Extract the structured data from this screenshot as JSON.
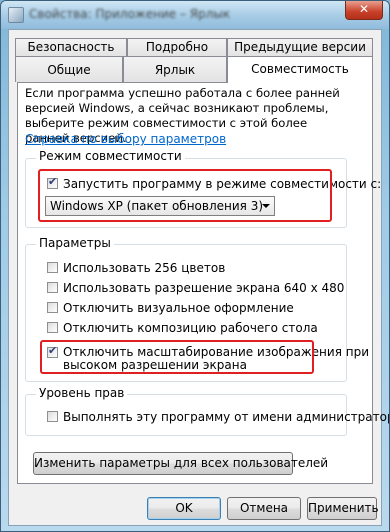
{
  "window": {
    "title": "Свойства: Приложение – Ярлык",
    "close_glyph": "✕"
  },
  "tabs": {
    "row1": [
      "Безопасность",
      "Подробно",
      "Предыдущие версии"
    ],
    "row2": [
      "Общие",
      "Ярлык",
      "Совместимость"
    ],
    "active": "Совместимость"
  },
  "intro_text": "Если программа успешно работала с более ранней версией Windows, а сейчас возникают проблемы, выберите режим совместимости с этой более ранней версией.",
  "help_link": "Справка по выбору параметров",
  "compat_group": {
    "title": "Режим совместимости",
    "run_compat_label": "Запустить программу в режиме совместимости с:",
    "run_compat_checked": true,
    "os_selected": "Windows XP (пакет обновления 3)"
  },
  "params_group": {
    "title": "Параметры",
    "options": [
      {
        "label": "Использовать 256 цветов",
        "checked": false
      },
      {
        "label": "Использовать разрешение экрана 640 x 480",
        "checked": false
      },
      {
        "label": "Отключить визуальное оформление",
        "checked": false
      },
      {
        "label": "Отключить композицию рабочего стола",
        "checked": false
      },
      {
        "label": "Отключить масштабирование изображения при высоком разрешении экрана",
        "checked": true
      }
    ],
    "dpi_line1": "Отключить масштабирование изображения при",
    "dpi_line2": "высоком разрешении экрана"
  },
  "privilege_group": {
    "title": "Уровень прав",
    "run_as_admin_label": "Выполнять эту программу от имени администратора",
    "run_as_admin_checked": false
  },
  "all_users_button": "Изменить параметры для всех пользователей",
  "buttons": {
    "ok": "OK",
    "cancel": "Отмена",
    "apply": "Применить"
  },
  "colors": {
    "highlight_box": "#e02020",
    "link": "#0066cc"
  }
}
